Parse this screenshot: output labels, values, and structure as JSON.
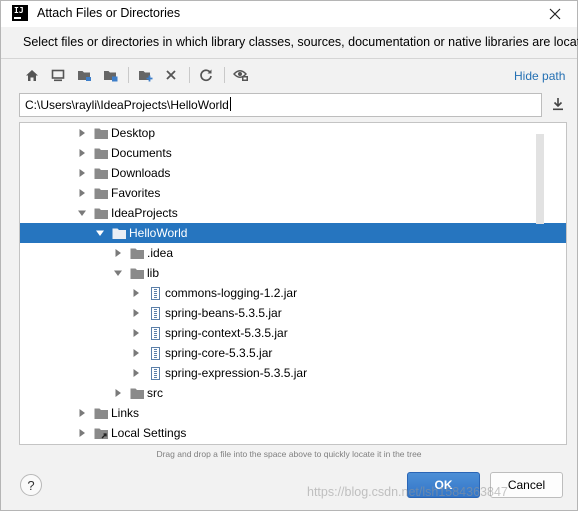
{
  "window": {
    "title": "Attach Files or Directories",
    "description": "Select files or directories in which library classes, sources, documentation or native libraries are located"
  },
  "toolbar": {
    "hide_path_label": "Hide path",
    "icons": [
      "home-icon",
      "desktop-icon",
      "project-folder-icon",
      "module-folder-icon",
      "new-folder-icon",
      "delete-icon",
      "refresh-icon",
      "show-hidden-icon"
    ]
  },
  "path": {
    "value": "C:\\Users\\rayli\\IdeaProjects\\HelloWorld"
  },
  "tree": {
    "items": [
      {
        "label": "Desktop",
        "type": "folder",
        "expanded": false
      },
      {
        "label": "Documents",
        "type": "folder",
        "expanded": false
      },
      {
        "label": "Downloads",
        "type": "folder",
        "expanded": false
      },
      {
        "label": "Favorites",
        "type": "folder",
        "expanded": false
      },
      {
        "label": "IdeaProjects",
        "type": "folder",
        "expanded": true
      },
      {
        "label": "HelloWorld",
        "type": "folder",
        "expanded": true,
        "selected": true
      },
      {
        "label": ".idea",
        "type": "folder",
        "expanded": false
      },
      {
        "label": "lib",
        "type": "folder",
        "expanded": true
      },
      {
        "label": "commons-logging-1.2.jar",
        "type": "jar",
        "expanded": false
      },
      {
        "label": "spring-beans-5.3.5.jar",
        "type": "jar",
        "expanded": false
      },
      {
        "label": "spring-context-5.3.5.jar",
        "type": "jar",
        "expanded": false
      },
      {
        "label": "spring-core-5.3.5.jar",
        "type": "jar",
        "expanded": false
      },
      {
        "label": "spring-expression-5.3.5.jar",
        "type": "jar",
        "expanded": false
      },
      {
        "label": "src",
        "type": "folder",
        "expanded": false
      },
      {
        "label": "Links",
        "type": "folder",
        "expanded": false
      },
      {
        "label": "Local Settings",
        "type": "link-folder",
        "expanded": false
      }
    ]
  },
  "hint": "Drag and drop a file into the space above to quickly locate it in the tree",
  "buttons": {
    "help": "?",
    "ok": "OK",
    "cancel": "Cancel"
  },
  "watermark": "https://blog.csdn.net/lsh1584363847",
  "colors": {
    "selection": "#2675bf",
    "link": "#2470b3",
    "ok_button": "#3b7fcf"
  }
}
